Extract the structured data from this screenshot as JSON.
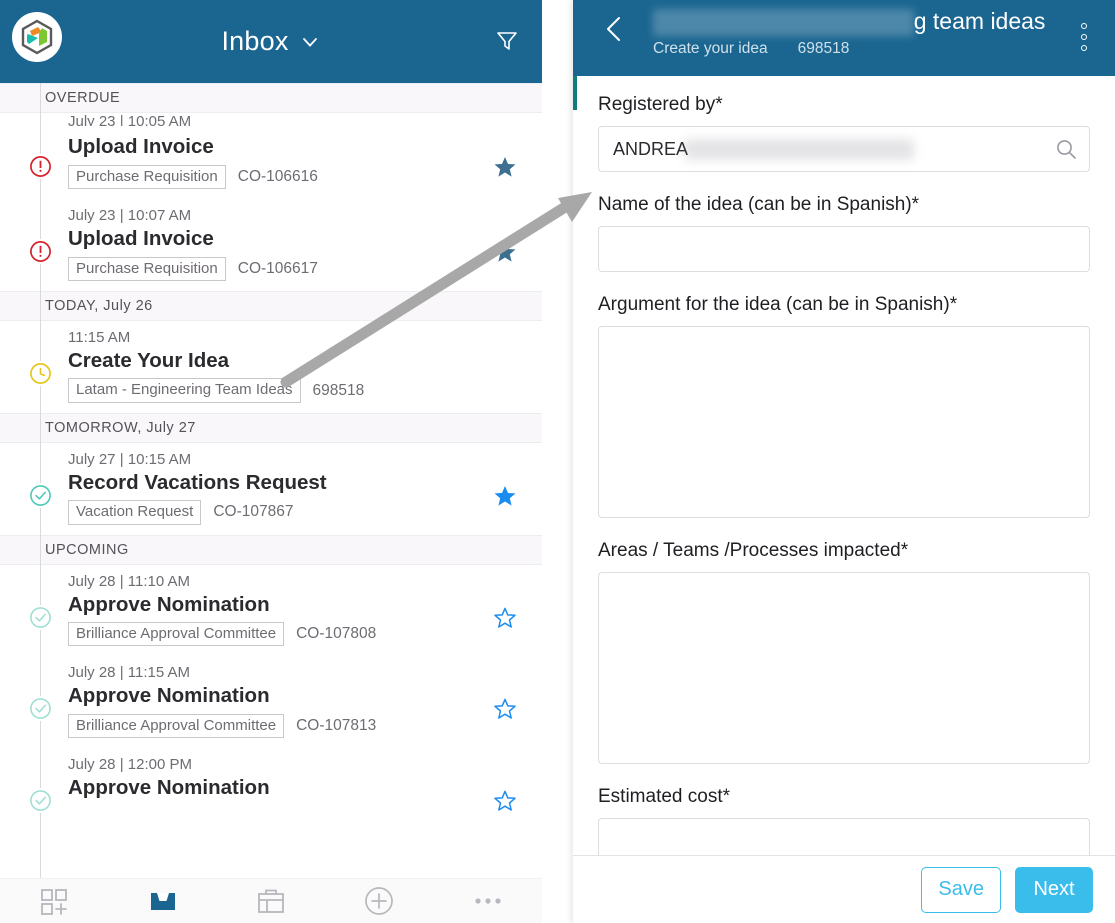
{
  "left_panel": {
    "header": {
      "logo_name": "app-logo",
      "title": "Inbox",
      "chevron_icon": "chevron-down-icon",
      "filter_icon": "filter-icon"
    },
    "groups": [
      {
        "label": "OVERDUE",
        "partial_time_above": "July 23 | 10:05 AM",
        "items": [
          {
            "time": "",
            "title": "Upload Invoice",
            "chip": "Purchase Requisition",
            "code": "CO-106616",
            "status_icon": "alert-circle-icon",
            "star_icon": "star-filled-icon",
            "star_state": "filled-muted"
          },
          {
            "time": "July 23 | 10:07 AM",
            "title": "Upload Invoice",
            "chip": "Purchase Requisition",
            "code": "CO-106617",
            "status_icon": "alert-circle-icon",
            "star_icon": "star-filled-icon",
            "star_state": "filled-muted"
          }
        ]
      },
      {
        "label": "TODAY, July 26",
        "items": [
          {
            "time": "11:15 AM",
            "title": "Create Your Idea",
            "chip": "Latam - Engineering Team Ideas",
            "code": "698518",
            "status_icon": "clock-circle-icon",
            "star_icon": "",
            "star_state": "none"
          }
        ]
      },
      {
        "label": "TOMORROW, July 27",
        "items": [
          {
            "time": "July 27 | 10:15 AM",
            "title": "Record Vacations Request",
            "chip": "Vacation Request",
            "code": "CO-107867",
            "status_icon": "check-circle-icon",
            "star_icon": "star-filled-icon",
            "star_state": "filled-blue"
          }
        ]
      },
      {
        "label": "UPCOMING",
        "items": [
          {
            "time": "July 28 | 11:10 AM",
            "title": "Approve Nomination",
            "chip": "Brilliance Approval Committee",
            "code": "CO-107808",
            "status_icon": "check-circle-icon",
            "star_icon": "star-outline-icon",
            "star_state": "outline-blue"
          },
          {
            "time": "July 28 | 11:15 AM",
            "title": "Approve Nomination",
            "chip": "Brilliance Approval Committee",
            "code": "CO-107813",
            "status_icon": "check-circle-icon",
            "star_icon": "star-outline-icon",
            "star_state": "outline-blue"
          },
          {
            "time": "July 28 | 12:00 PM",
            "title": "Approve Nomination",
            "chip": "",
            "code": "",
            "status_icon": "check-circle-icon",
            "star_icon": "star-outline-icon",
            "star_state": "outline-blue"
          }
        ]
      }
    ],
    "bottom_nav": [
      {
        "name": "nav-new-item",
        "icon": "grid-plus-icon",
        "active": false
      },
      {
        "name": "nav-inbox",
        "icon": "inbox-icon",
        "active": true
      },
      {
        "name": "nav-briefcase",
        "icon": "briefcase-icon",
        "active": false
      },
      {
        "name": "nav-add",
        "icon": "plus-circle-icon",
        "active": false
      },
      {
        "name": "nav-more",
        "icon": "more-horizontal-icon",
        "active": false
      }
    ]
  },
  "right_modal": {
    "header": {
      "back_icon": "back-chevron-icon",
      "title_redacted": "████████████████",
      "title_visible": "g team ideas",
      "subtitle": "Create your idea",
      "subtitle_code": "698518",
      "overflow_icon": "more-vertical-icon"
    },
    "fields": [
      {
        "label": "Registered by*",
        "type": "search-input",
        "value": "ANDREA",
        "value_redacted": "██████████████████",
        "icon": "search-icon",
        "placeholder": ""
      },
      {
        "label": "Name of the idea (can be in Spanish)*",
        "type": "input",
        "value": "",
        "placeholder": ""
      },
      {
        "label": "Argument for the idea (can be in Spanish)*",
        "type": "textarea-tall",
        "value": "",
        "placeholder": ""
      },
      {
        "label": "Areas / Teams /Processes impacted*",
        "type": "textarea-med",
        "value": "",
        "placeholder": ""
      },
      {
        "label": "Estimated cost*",
        "type": "textarea-short",
        "value": "",
        "placeholder": ""
      }
    ],
    "footer": {
      "save_label": "Save",
      "next_label": "Next"
    }
  },
  "annotation": {
    "arrow_icon": "pointer-arrow-icon"
  },
  "colors": {
    "header_blue": "#1b6691",
    "accent_cyan": "#3bbdec",
    "star_blue": "#1a8cf0",
    "star_muted": "#3d6f91",
    "alert_red": "#d6222c",
    "clock_yellow": "#e8c71c",
    "check_teal": "#4ec9b6",
    "group_bg": "#faf7fa",
    "teal_accent": "#107c7c"
  }
}
